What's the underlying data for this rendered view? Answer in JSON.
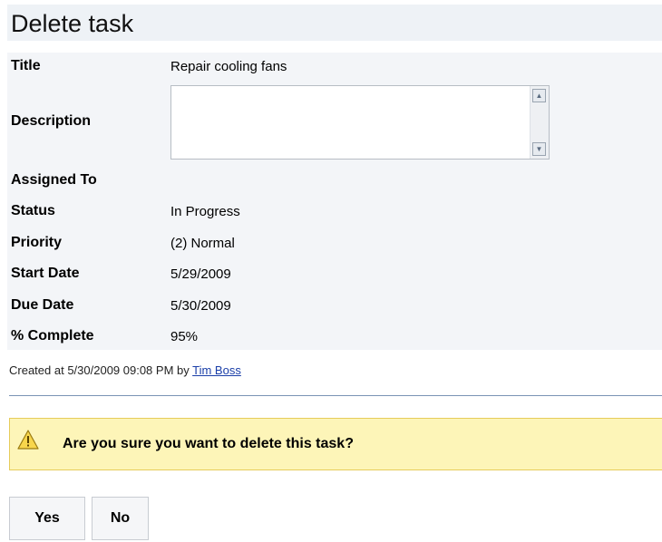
{
  "page": {
    "title": "Delete task"
  },
  "details": {
    "title_label": "Title",
    "title_value": "Repair cooling fans",
    "description_label": "Description",
    "description_value": "",
    "assigned_to_label": "Assigned To",
    "assigned_to_value": "",
    "status_label": "Status",
    "status_value": "In Progress",
    "priority_label": "Priority",
    "priority_value": "(2) Normal",
    "start_date_label": "Start Date",
    "start_date_value": "5/29/2009",
    "due_date_label": "Due Date",
    "due_date_value": "5/30/2009",
    "complete_label": "% Complete",
    "complete_value": "95%"
  },
  "meta": {
    "created_prefix": "Created at 5/30/2009 09:08 PM by ",
    "created_by": "Tim Boss"
  },
  "confirm": {
    "icon": "warning-icon",
    "message": "Are you sure you want to delete this task?",
    "yes_label": "Yes",
    "no_label": "No"
  },
  "colors": {
    "warning_bg": "#fdf5b8",
    "warning_border": "#e6cc5a",
    "link": "#1a3ea8",
    "divider": "#7a93b5"
  }
}
